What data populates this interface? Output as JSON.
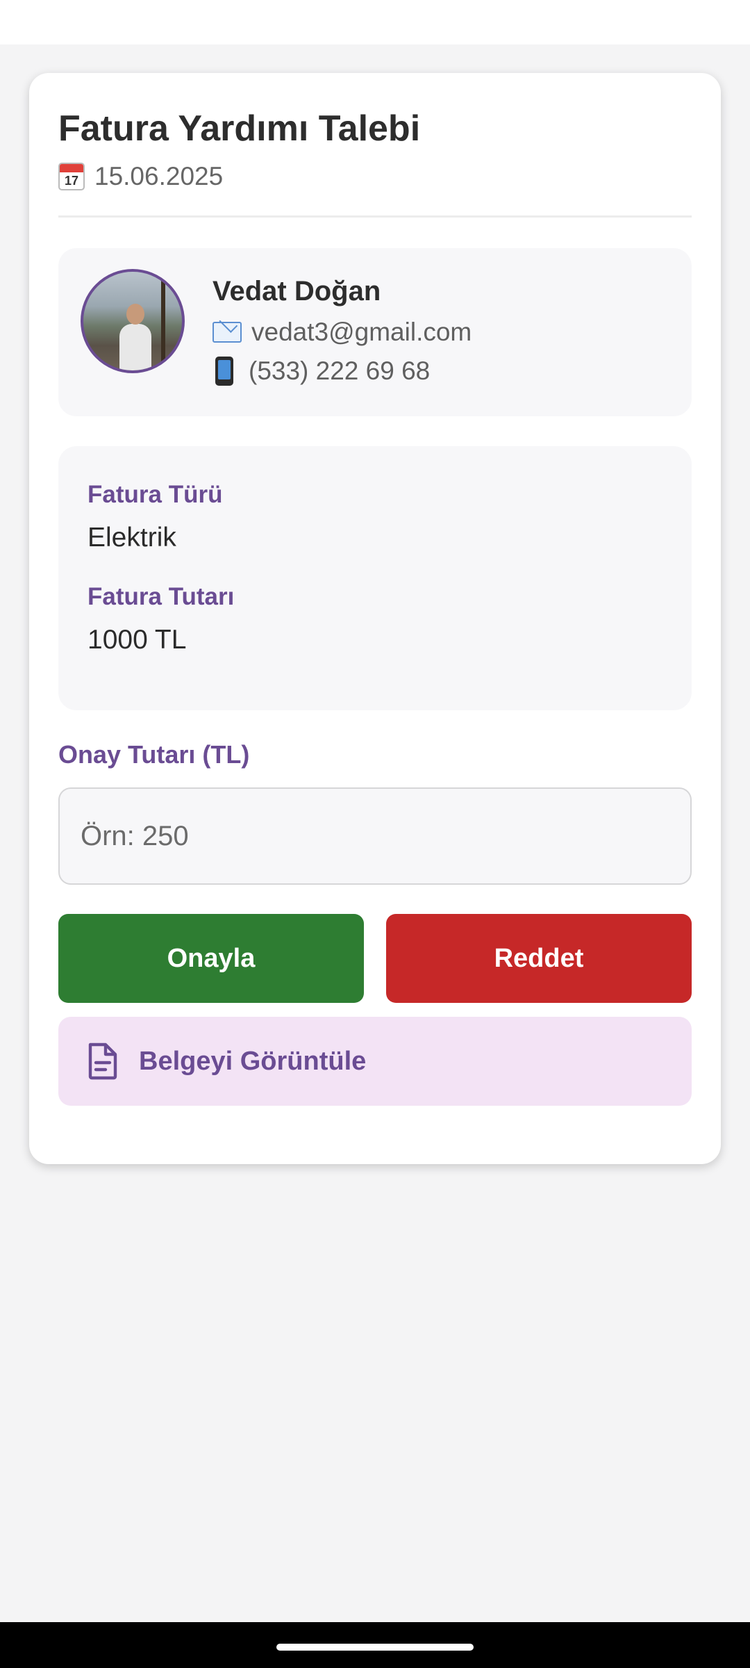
{
  "header": {
    "title": "Fatura Yardımı Talebi",
    "date": "15.06.2025",
    "calendar_icon_day": "17"
  },
  "applicant": {
    "name": "Vedat Doğan",
    "email": "vedat3@gmail.com",
    "phone": "(533) 222 69 68"
  },
  "details": {
    "type_label": "Fatura Türü",
    "type_value": "Elektrik",
    "amount_label": "Fatura Tutarı",
    "amount_value": "1000 TL"
  },
  "approval": {
    "label": "Onay Tutarı (TL)",
    "input_value": "",
    "placeholder": "Örn: 250"
  },
  "actions": {
    "approve_label": "Onayla",
    "reject_label": "Reddet",
    "view_document_label": "Belgeyi Görüntüle"
  },
  "colors": {
    "accent": "#6a4c93",
    "approve": "#2e7d32",
    "reject": "#c62828",
    "document_bg": "#f3e3f5"
  },
  "icons": {
    "date": "calendar-icon",
    "email": "email-icon",
    "phone": "mobile-phone-icon",
    "document": "document-icon"
  }
}
